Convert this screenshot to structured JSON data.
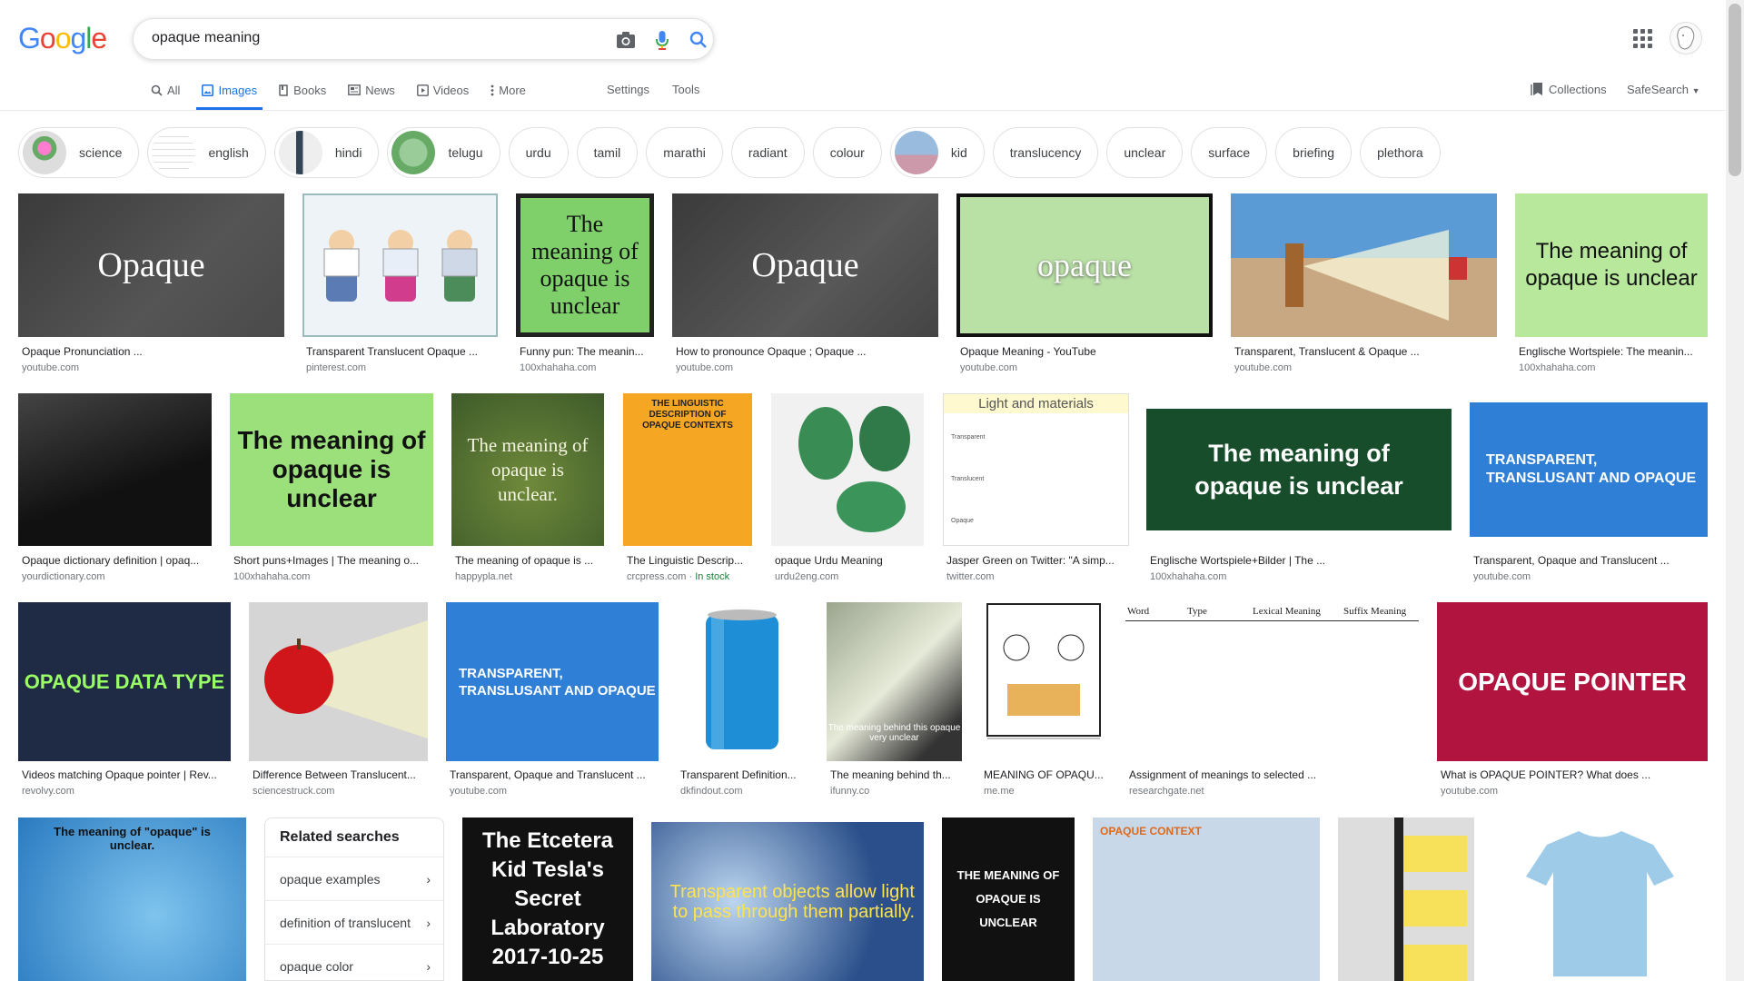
{
  "search": {
    "query": "opaque meaning"
  },
  "logo": {
    "letters": [
      "G",
      "o",
      "o",
      "g",
      "l",
      "e"
    ]
  },
  "tabs": [
    {
      "label": "All",
      "icon": "search-icon"
    },
    {
      "label": "Images",
      "icon": "image-icon",
      "active": true
    },
    {
      "label": "Books",
      "icon": "book-icon"
    },
    {
      "label": "News",
      "icon": "news-icon"
    },
    {
      "label": "Videos",
      "icon": "video-icon"
    },
    {
      "label": "More",
      "icon": "more-vert-icon"
    }
  ],
  "toolbar": {
    "settings": "Settings",
    "tools": "Tools",
    "collections": "Collections",
    "safesearch": "SafeSearch"
  },
  "chips": [
    {
      "label": "science",
      "thumb": true
    },
    {
      "label": "english",
      "thumb": true
    },
    {
      "label": "hindi",
      "thumb": true
    },
    {
      "label": "telugu",
      "thumb": true
    },
    {
      "label": "urdu"
    },
    {
      "label": "tamil"
    },
    {
      "label": "marathi"
    },
    {
      "label": "radiant"
    },
    {
      "label": "colour"
    },
    {
      "label": "kid",
      "thumb": true
    },
    {
      "label": "translucency"
    },
    {
      "label": "unclear"
    },
    {
      "label": "surface"
    },
    {
      "label": "briefing"
    },
    {
      "label": "plethora"
    }
  ],
  "rows": [
    [
      {
        "caption": "Opaque Pronunciation ...",
        "source": "youtube.com",
        "text": "Opaque"
      },
      {
        "caption": "Transparent Translucent Opaque ...",
        "source": "pinterest.com",
        "text": ""
      },
      {
        "caption": "Funny pun: The meanin...",
        "source": "100xhahaha.com",
        "text": "The meaning of opaque is unclear"
      },
      {
        "caption": "How to pronounce Opaque ; Opaque ...",
        "source": "youtube.com",
        "text": "Opaque"
      },
      {
        "caption": "Opaque Meaning - YouTube",
        "source": "youtube.com",
        "text": "opaque"
      },
      {
        "caption": "Transparent, Translucent & Opaque ...",
        "source": "youtube.com",
        "text": ""
      },
      {
        "caption": "Englische Wortspiele: The meanin...",
        "source": "100xhahaha.com",
        "text": "The meaning of opaque is unclear"
      }
    ],
    [
      {
        "caption": "Opaque dictionary definition | opaq...",
        "source": "yourdictionary.com",
        "text": ""
      },
      {
        "caption": "Short puns+Images | The meaning o...",
        "source": "100xhahaha.com",
        "text": "The meaning of opaque is unclear"
      },
      {
        "caption": "The meaning of opaque is ...",
        "source": "happypla.net",
        "text": "The meaning of opaque is unclear."
      },
      {
        "caption": "The Linguistic Descrip...",
        "source": "crcpress.com",
        "stock": "In stock",
        "text": "THE LINGUISTIC DESCRIPTION OF OPAQUE CONTEXTS"
      },
      {
        "caption": "opaque Urdu Meaning",
        "source": "urdu2eng.com",
        "text": ""
      },
      {
        "caption": "Jasper Green on Twitter: \"A simp...",
        "source": "twitter.com",
        "text": "Light and materials"
      },
      {
        "caption": "Englische Wortspiele+Bilder | The ...",
        "source": "100xhahaha.com",
        "text": "The meaning of opaque is unclear"
      },
      {
        "caption": "Transparent, Opaque and Translucent ...",
        "source": "youtube.com",
        "text": "TRANSPARENT, TRANSLUSANT AND OPAQUE"
      }
    ],
    [
      {
        "caption": "Videos matching Opaque pointer | Rev...",
        "source": "revolvy.com",
        "text": "OPAQUE DATA TYPE"
      },
      {
        "caption": "Difference Between Translucent...",
        "source": "sciencestruck.com",
        "text": ""
      },
      {
        "caption": "Transparent, Opaque and Translucent ...",
        "source": "youtube.com",
        "text": "TRANSPARENT, TRANSLUSANT AND OPAQUE"
      },
      {
        "caption": "Transparent Definition...",
        "source": "dkfindout.com",
        "text": ""
      },
      {
        "caption": "The meaning behind th...",
        "source": "ifunny.co",
        "text": "The meaning behind this opaque very unclear"
      },
      {
        "caption": "MEANING OF OPAQU...",
        "source": "me.me",
        "text": ""
      },
      {
        "caption": "Assignment of meanings to selected ...",
        "source": "researchgate.net",
        "text": ""
      },
      {
        "caption": "What is OPAQUE POINTER? What does ...",
        "source": "youtube.com",
        "text": "OPAQUE POINTER"
      }
    ],
    [
      {
        "text": "The meaning of \"opaque\" is unclear."
      },
      {
        "text": "The Etcetera Kid Tesla's Secret Laboratory 2017-10-25"
      },
      {
        "text": "Transparent objects allow light to pass through them partially."
      },
      {
        "text": "THE MEANING OF OPAQUE IS UNCLEAR"
      },
      {
        "text": "OPAQUE CONTEXT"
      },
      {
        "text": ""
      },
      {
        "text": ""
      }
    ]
  ],
  "related": {
    "title": "Related searches",
    "items": [
      "opaque examples",
      "definition of translucent",
      "opaque color"
    ]
  },
  "table_words": {
    "header": [
      "Word",
      "Type",
      "Lexical Meaning",
      "Suffix Meaning"
    ]
  },
  "light_table": [
    "Transparent",
    "Translucent",
    "Opaque"
  ],
  "tshirt_text": "",
  "colors": {
    "accent": "#1a73e8",
    "blue": "#4285f4",
    "red": "#ea4335",
    "yellow": "#fbbc05",
    "green": "#34a853"
  }
}
